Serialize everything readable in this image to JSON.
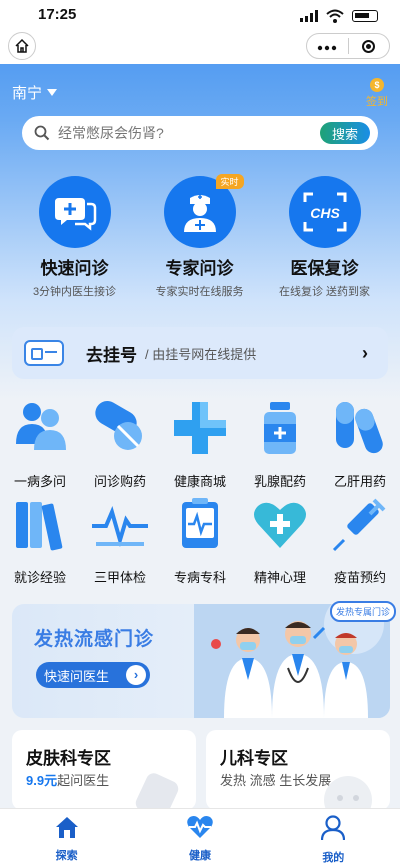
{
  "status": {
    "time": "17:25"
  },
  "nav": {
    "home_icon": "home-icon",
    "more_icon": "more-dots-icon",
    "close_icon": "target-close-icon"
  },
  "header": {
    "city": "南宁",
    "signin_label": "签到",
    "signin_coin": "$"
  },
  "search": {
    "placeholder": "经常憋尿会伤肾?",
    "button": "搜索"
  },
  "top_services": [
    {
      "title": "快速问诊",
      "subtitle": "3分钟内医生接诊",
      "icon": "chat-plus-icon"
    },
    {
      "title": "专家问诊",
      "subtitle": "专家实时在线服务",
      "icon": "doctor-icon",
      "tag": "实时"
    },
    {
      "title": "医保复诊",
      "subtitle": "在线复诊  送药到家",
      "icon": "chs-scan-icon",
      "icon_text": "CHS"
    }
  ],
  "register": {
    "title": "去挂号",
    "subtitle": "/ 由挂号网在线提供",
    "arrow": "›"
  },
  "grid": [
    {
      "label": "一病多问",
      "icon": "people-icon"
    },
    {
      "label": "问诊购药",
      "icon": "pill-icon"
    },
    {
      "label": "健康商城",
      "icon": "cross-icon"
    },
    {
      "label": "乳腺配药",
      "icon": "medicine-bottle-icon"
    },
    {
      "label": "乙肝用药",
      "icon": "capsule-icon"
    },
    {
      "label": "就诊经验",
      "icon": "books-icon"
    },
    {
      "label": "三甲体检",
      "icon": "heartbeat-icon"
    },
    {
      "label": "专病专科",
      "icon": "monitor-icon"
    },
    {
      "label": "精神心理",
      "icon": "heart-plus-icon"
    },
    {
      "label": "疫苗预约",
      "icon": "syringe-icon"
    }
  ],
  "banner": {
    "title": "发热流感门诊",
    "button": "快速问医生",
    "button_arrow": "›",
    "badge": "发热专属门诊"
  },
  "cards": [
    {
      "title": "皮肤科专区",
      "price": "9.9元",
      "subtitle": "起问医生"
    },
    {
      "title": "儿科专区",
      "subtitle": "发热  流感  生长发展"
    }
  ],
  "tabs": [
    {
      "label": "探索",
      "icon": "home-icon"
    },
    {
      "label": "健康",
      "icon": "heart-pulse-icon"
    },
    {
      "label": "我的",
      "icon": "user-icon"
    }
  ]
}
